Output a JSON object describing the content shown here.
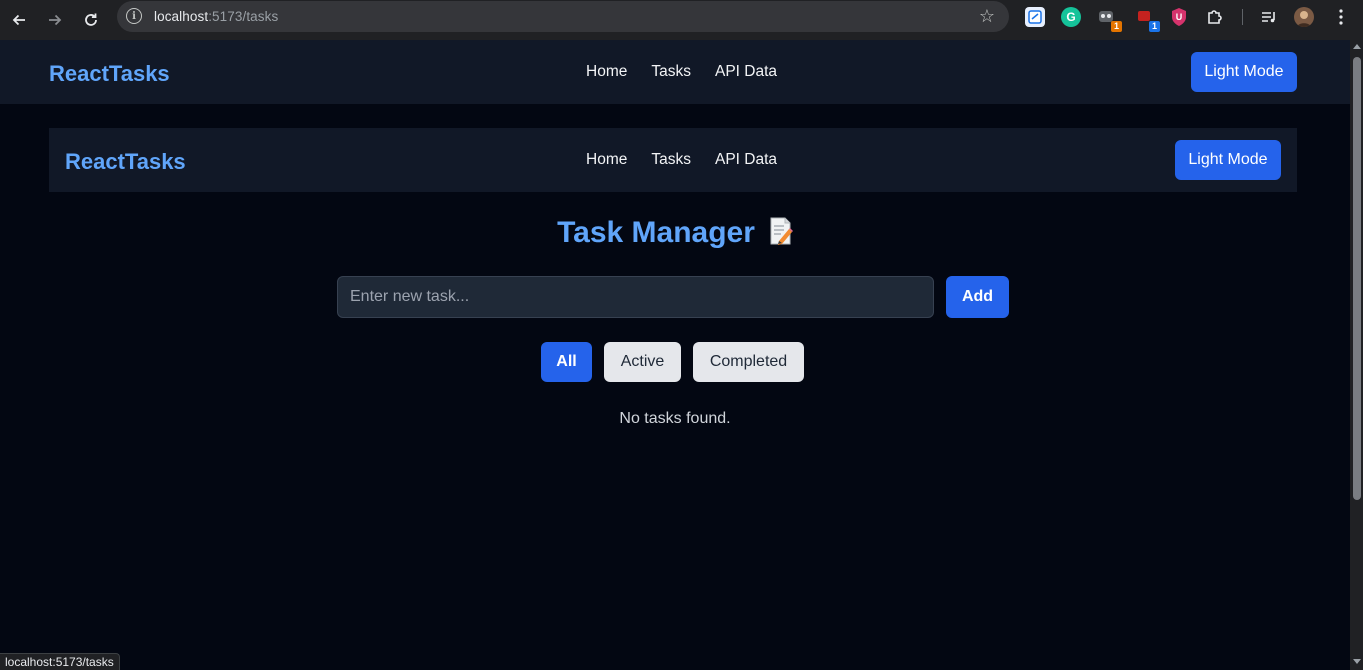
{
  "browser": {
    "url_host": "localhost",
    "url_path": ":5173/tasks",
    "extensions": [
      "copy-icon",
      "grammarly-icon",
      "tamper-icon",
      "todo-icon",
      "ublock-icon",
      "puzzle-icon"
    ],
    "badges": {
      "tamper": "1",
      "todo": "1"
    },
    "status_url": "localhost:5173/tasks"
  },
  "header": {
    "brand": "ReactTasks",
    "links": [
      "Home",
      "Tasks",
      "API Data"
    ],
    "mode_label": "Light Mode"
  },
  "inner_header": {
    "brand": "ReactTasks",
    "links": [
      "Home",
      "Tasks",
      "API Data"
    ],
    "mode_label": "Light Mode"
  },
  "main": {
    "title": "Task Manager",
    "title_icon": "memo-icon",
    "input_placeholder": "Enter new task...",
    "input_value": "",
    "add_label": "Add",
    "filters": [
      "All",
      "Active",
      "Completed"
    ],
    "selected_filter": "All",
    "empty_message": "No tasks found."
  },
  "colors": {
    "accent": "#2563eb",
    "brand_text": "#60a5fa",
    "background": "#030712",
    "nav_background": "#111827"
  }
}
